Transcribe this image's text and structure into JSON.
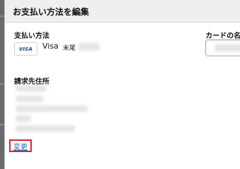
{
  "modal": {
    "title": "お支払い方法を編集"
  },
  "payment": {
    "label": "支払い方法",
    "card_logo": "VISA",
    "card_brand": "Visa",
    "card_suffix_prefix": "末尾"
  },
  "card_name": {
    "label": "カードの名"
  },
  "billing_address": {
    "label": "請求先住所",
    "lines_redacted": true
  },
  "change_link": {
    "label": "変更"
  },
  "colors": {
    "link": "#1f6fb5",
    "highlight_border": "#d9252c",
    "header_bg": "#efefef"
  }
}
